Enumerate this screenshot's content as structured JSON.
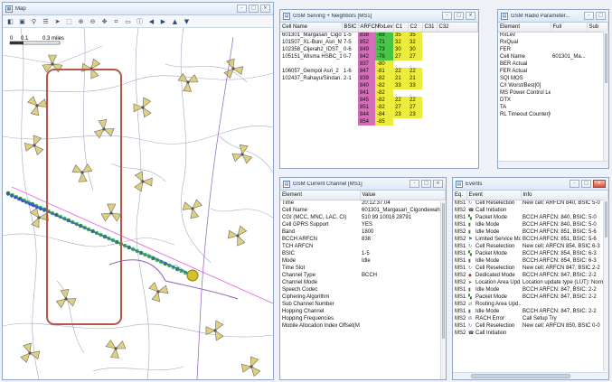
{
  "map": {
    "title": "Map",
    "scale": [
      "0",
      "0.1",
      "0.3 miles"
    ],
    "toolbar_icons": [
      "layers-icon",
      "map-icon",
      "pin-icon",
      "list-icon",
      "pointer-icon",
      "select-icon",
      "zoom-in-icon",
      "zoom-out-icon",
      "pan-icon",
      "measure-icon",
      "legend-icon",
      "info-icon",
      "arrow-left-icon",
      "arrow-right-icon",
      "arrow-up-icon",
      "arrow-down-icon"
    ]
  },
  "serving": {
    "title": "GSM Serving + Neighbors [MS1]",
    "columns": [
      "Cell Name",
      "BSIC",
      "ARFCN",
      "RxLev",
      "C1",
      "C2",
      "C31",
      "C32"
    ],
    "rows": [
      {
        "cell": "601301_Margasari_Cigo...",
        "bsic": "1-5",
        "arfcn": "838",
        "rxlev": "-69",
        "c1": "35",
        "c2": "35"
      },
      {
        "cell": "101507_XL-Buni_Asri_M...",
        "bsic": "7-5",
        "arfcn": "852",
        "rxlev": "-71",
        "c1": "32",
        "c2": "32"
      },
      {
        "cell": "102358_Cijerah2_IDST_2",
        "bsic": "0-6",
        "arfcn": "849",
        "rxlev": "-73",
        "c1": "30",
        "c2": "30"
      },
      {
        "cell": "105151_Wisma HSBC_1",
        "bsic": "0-7",
        "arfcn": "842",
        "rxlev": "-76",
        "c1": "27",
        "c2": "27"
      },
      {
        "cell": "",
        "bsic": "",
        "arfcn": "837",
        "rxlev": "-80",
        "c1": "",
        "c2": ""
      },
      {
        "cell": "106057_Gempol Asri_2",
        "bsic": "1-6",
        "arfcn": "847",
        "rxlev": "-81",
        "c1": "22",
        "c2": "22"
      },
      {
        "cell": "102437_Rahayu/Sindan...",
        "bsic": "2-1",
        "arfcn": "839",
        "rxlev": "-82",
        "c1": "21",
        "c2": "21"
      },
      {
        "cell": "",
        "bsic": "",
        "arfcn": "840",
        "rxlev": "-82",
        "c1": "33",
        "c2": "33"
      },
      {
        "cell": "",
        "bsic": "",
        "arfcn": "841",
        "rxlev": "-82",
        "c1": "",
        "c2": ""
      },
      {
        "cell": "",
        "bsic": "",
        "arfcn": "845",
        "rxlev": "-82",
        "c1": "22",
        "c2": "22"
      },
      {
        "cell": "",
        "bsic": "",
        "arfcn": "851",
        "rxlev": "-82",
        "c1": "27",
        "c2": "27"
      },
      {
        "cell": "",
        "bsic": "",
        "arfcn": "844",
        "rxlev": "-84",
        "c1": "23",
        "c2": "23"
      },
      {
        "cell": "",
        "bsic": "",
        "arfcn": "854",
        "rxlev": "-85",
        "c1": "",
        "c2": ""
      }
    ],
    "colors": {
      "arfcn": "#d36fb9",
      "rxlev_serving": "#49c449",
      "rxlev_neighbor": "#ecec3d",
      "c_values": "#ecec3d"
    }
  },
  "radio": {
    "title": "GSM Radio Parameter...",
    "columns": [
      "Element",
      "Full",
      "Sub"
    ],
    "rows": [
      {
        "element": "RxLev",
        "full": "",
        "sub": ""
      },
      {
        "element": "RxQual",
        "full": "",
        "sub": ""
      },
      {
        "element": "FER",
        "full": "",
        "sub": ""
      },
      {
        "element": "Cell Name",
        "full": "601301_Ma...",
        "sub": ""
      },
      {
        "element": "BER Actual",
        "full": "",
        "sub": ""
      },
      {
        "element": "FER Actual",
        "full": "",
        "sub": ""
      },
      {
        "element": "SQI MOS",
        "full": "",
        "sub": ""
      },
      {
        "element": "C/I Worst/Best[0]",
        "full": "",
        "sub": ""
      },
      {
        "element": "MS Power Control Level",
        "full": "",
        "sub": ""
      },
      {
        "element": "DTX",
        "full": "",
        "sub": ""
      },
      {
        "element": "TA",
        "full": "",
        "sub": ""
      },
      {
        "element": "RL Timeout Counter[Cur]",
        "full": "",
        "sub": ""
      }
    ],
    "rxlev_bar_color": "#39b739"
  },
  "channel": {
    "title": "GSM Current Channel [MS1]",
    "columns": [
      "Element",
      "Value"
    ],
    "rows": [
      {
        "element": "Time",
        "value": "20:12:37.04"
      },
      {
        "element": "Cell Name",
        "value": "601301_Margasari_Cigondewah_"
      },
      {
        "element": "CGI (MCC, MNC, LAC, CI)",
        "value": "510 89 10016 28791"
      },
      {
        "element": "Cell GPRS Support",
        "value": "YES"
      },
      {
        "element": "Band",
        "value": "1800"
      },
      {
        "element": "BCCH ARFCN",
        "value": "838"
      },
      {
        "element": "TCH ARFCN",
        "value": ""
      },
      {
        "element": "BSIC",
        "value": "1-5"
      },
      {
        "element": "Mode",
        "value": "Idle"
      },
      {
        "element": "Time Slot",
        "value": ""
      },
      {
        "element": "Channel Type",
        "value": "BCCH"
      },
      {
        "element": "Channel Mode",
        "value": ""
      },
      {
        "element": "Speech Codec",
        "value": ""
      },
      {
        "element": "Ciphering Algorithm",
        "value": ""
      },
      {
        "element": "Sub Channel Number",
        "value": ""
      },
      {
        "element": "Hopping Channel",
        "value": ""
      },
      {
        "element": "Hopping Frequencies",
        "value": ""
      },
      {
        "element": "Mobile Allocation Index Offset(MAIO)",
        "value": ""
      }
    ]
  },
  "events": {
    "title": "Events",
    "columns": [
      "Eq.",
      "Event",
      "Info"
    ],
    "rows": [
      {
        "eq": "MS1",
        "icon": "reselect-icon",
        "color": "#2f5fb3",
        "event": "Cell Reselection",
        "info": "New cell: ARFCN 840, BSIC 5-0"
      },
      {
        "eq": "MS2",
        "icon": "phone-icon",
        "color": "#333333",
        "event": "Call Initiation",
        "info": ""
      },
      {
        "eq": "MS1",
        "icon": "packet-icon",
        "color": "#2d8a2d",
        "event": "Packet Mode",
        "info": "BCCH ARFCN: 840, BSIC: 5-0"
      },
      {
        "eq": "MS1",
        "icon": "idle-icon",
        "color": "#3a7a3a",
        "event": "Idle Mode",
        "info": "BCCH ARFCN: 840, BSIC: 5-0"
      },
      {
        "eq": "MS2",
        "icon": "idle-icon",
        "color": "#3a7a3a",
        "event": "Idle Mode",
        "info": "BCCH ARFCN: 851, BSIC: 5-6"
      },
      {
        "eq": "MS2",
        "icon": "limited-icon",
        "color": "#2f5fb3",
        "event": "Limited Service Mo...",
        "info": "BCCH ARFCN: 851, BSIC: 5-6"
      },
      {
        "eq": "MS1",
        "icon": "reselect-icon",
        "color": "#2f5fb3",
        "event": "Cell Reselection",
        "info": "New cell: ARFCN 854, BSIC 6-3"
      },
      {
        "eq": "MS1",
        "icon": "packet-icon",
        "color": "#2d8a2d",
        "event": "Packet Mode",
        "info": "BCCH ARFCN: 854, BSIC: 6-3"
      },
      {
        "eq": "MS1",
        "icon": "idle-icon",
        "color": "#3a7a3a",
        "event": "Idle Mode",
        "info": "BCCH ARFCN: 854, BSIC: 6-3"
      },
      {
        "eq": "MS1",
        "icon": "reselect-icon",
        "color": "#2f5fb3",
        "event": "Cell Reselection",
        "info": "New cell: ARFCN 847, BSIC 2-2"
      },
      {
        "eq": "MS2",
        "icon": "dedicated-icon",
        "color": "#b33a2f",
        "event": "Dedicated Mode",
        "info": "BCCH ARFCN: 847, BSIC: 2-2"
      },
      {
        "eq": "MS2",
        "icon": "location-icon",
        "color": "#555555",
        "event": "Location Area Upd...",
        "info": "Location update type (LUT): Norma"
      },
      {
        "eq": "MS1",
        "icon": "idle-icon",
        "color": "#3a7a3a",
        "event": "Idle Mode",
        "info": "BCCH ARFCN: 847, BSIC: 2-2"
      },
      {
        "eq": "MS1",
        "icon": "packet-icon",
        "color": "#2d8a2d",
        "event": "Packet Mode",
        "info": "BCCH ARFCN: 847, BSIC: 2-2"
      },
      {
        "eq": "MS2",
        "icon": "routing-icon",
        "color": "#555555",
        "event": "Routing Area Upd...",
        "info": ""
      },
      {
        "eq": "MS1",
        "icon": "idle-icon",
        "color": "#3a7a3a",
        "event": "Idle Mode",
        "info": "BCCH ARFCN: 847, BSIC: 2-2"
      },
      {
        "eq": "MS2",
        "icon": "rach-icon",
        "color": "#2f5fb3",
        "event": "RACH Error",
        "info": "Call Setup Try"
      },
      {
        "eq": "MS1",
        "icon": "reselect-icon",
        "color": "#2f5fb3",
        "event": "Cell Reselection",
        "info": "New cell: ARFCN 850, BSIC 0-0"
      },
      {
        "eq": "MS2",
        "icon": "phone-icon",
        "color": "#333333",
        "event": "Call Initiation",
        "info": ""
      }
    ]
  }
}
